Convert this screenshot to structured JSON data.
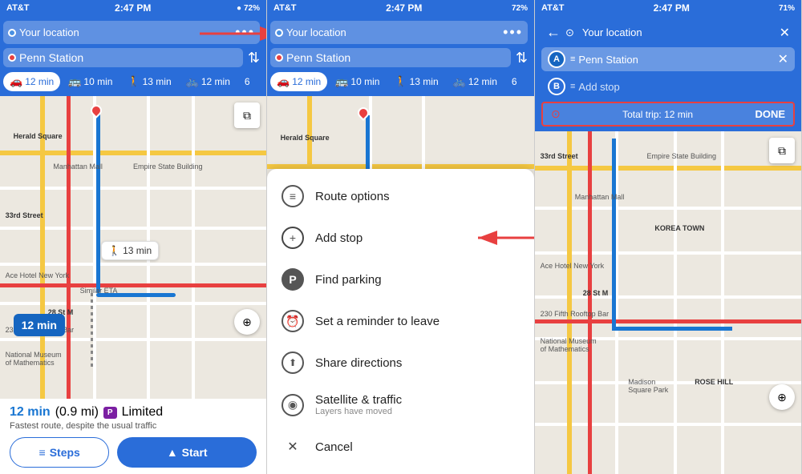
{
  "panels": [
    {
      "id": "left",
      "statusBar": {
        "carrier": "AT&T",
        "wifi": true,
        "time": "2:47 PM",
        "bluetooth": true,
        "battery": "72%"
      },
      "header": {
        "backIcon": "←",
        "originLabel": "Your location",
        "destinationLabel": "Penn Station",
        "swapIcon": "⇅",
        "moreIcon": "•••"
      },
      "transportTabs": [
        {
          "icon": "🚗",
          "label": "12 min",
          "active": true
        },
        {
          "icon": "🚌",
          "label": "10 min",
          "active": false
        },
        {
          "icon": "🚶",
          "label": "13 min",
          "active": false
        },
        {
          "icon": "🚲",
          "label": "12 min",
          "active": false
        },
        {
          "icon": "🚲",
          "label": "6",
          "active": false
        }
      ],
      "map": {
        "timeBadge": "12 min",
        "walkBadge": "13 min",
        "walkIcon": "🚶",
        "similarEta": "Similar ETA",
        "landmarks": [
          "Herald Square",
          "Manhattan Mall",
          "Empire State Building",
          "33rd Street",
          "Ace Hotel New York",
          "28 St M",
          "230 Fifth Rooftop Bar",
          "National Museum of Mathematics"
        ]
      },
      "bottomBar": {
        "time": "12 min",
        "distance": "(0.9 mi)",
        "parkingLabel": "P",
        "parkingText": "Limited",
        "subText": "Fastest route, despite the usual traffic",
        "stepsLabel": "Steps",
        "startLabel": "Start"
      }
    },
    {
      "id": "middle",
      "statusBar": {
        "carrier": "AT&T",
        "wifi": true,
        "time": "2:47 PM",
        "bluetooth": true,
        "battery": "72%"
      },
      "header": {
        "backIcon": "←",
        "originLabel": "Your location",
        "destinationLabel": "Penn Station",
        "swapIcon": "⇅",
        "moreIcon": "•••"
      },
      "transportTabs": [
        {
          "icon": "🚗",
          "label": "12 min",
          "active": true
        },
        {
          "icon": "🚌",
          "label": "10 min",
          "active": false
        },
        {
          "icon": "🚶",
          "label": "13 min",
          "active": false
        },
        {
          "icon": "🚲",
          "label": "12 min",
          "active": false
        },
        {
          "icon": "🚲",
          "label": "6",
          "active": false
        }
      ],
      "menu": {
        "items": [
          {
            "icon": "≡",
            "label": "Route options",
            "sub": ""
          },
          {
            "icon": "+",
            "label": "Add stop",
            "sub": "",
            "highlighted": true
          },
          {
            "icon": "P",
            "label": "Find parking",
            "sub": "",
            "isP": true
          },
          {
            "icon": "⏰",
            "label": "Set a reminder to leave",
            "sub": ""
          },
          {
            "icon": "↑",
            "label": "Share directions",
            "sub": ""
          },
          {
            "icon": "👁",
            "label": "Satellite & traffic",
            "sub": "Layers have moved"
          },
          {
            "icon": "✕",
            "label": "Cancel",
            "sub": "",
            "isX": true
          }
        ]
      }
    },
    {
      "id": "right",
      "statusBar": {
        "carrier": "AT&T",
        "wifi": true,
        "time": "2:47 PM",
        "bluetooth": true,
        "battery": "71%"
      },
      "header": {
        "backIcon": "←",
        "originLabel": "Your location",
        "closeIcon": "✕"
      },
      "stops": [
        {
          "letter": "A",
          "label": "Penn Station",
          "removable": true
        },
        {
          "letter": "B",
          "label": "Add stop",
          "removable": false
        }
      ],
      "totalTrip": {
        "label": "Total trip: 12 min",
        "doneLabel": "DONE"
      },
      "map": {
        "landmark": "KOREA TOWN",
        "landmarks2": [
          "33rd Street",
          "Manhattan Mall",
          "Empire State Building",
          "Ace Hotel New York",
          "28 St M",
          "230 Fifth Rooftop Bar",
          "National Museum of Mathematics",
          "Madison Square Park",
          "ROSE HILL"
        ]
      }
    }
  ],
  "annotations": {
    "arrow1": "→",
    "arrow2": "←"
  }
}
